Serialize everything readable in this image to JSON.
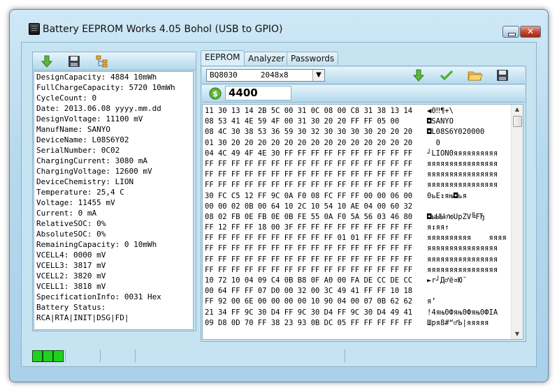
{
  "window": {
    "title": "Battery EEPROM Works  4.05 Bohol (USB to GPIO)",
    "close_label": "✕"
  },
  "left_toolbar": {
    "icons": [
      "read-arrow-icon",
      "save-icon",
      "tree-icon"
    ]
  },
  "info_lines": [
    "DesignCapacity: 4884 10mWh",
    "FullChargeCapacity: 5720 10mWh",
    "CycleCount: 0",
    "Date: 2013.06.08 yyyy.mm.dd",
    "DesignVoltage: 11100 mV",
    "ManufName: SANYO",
    "DeviceName: L08S6Y02",
    "SerialNumber: 0C02",
    "ChargingCurrent: 3080 mA",
    "ChargingVoltage: 12600 mV",
    "DeviceChemistry: LION",
    "Temperature: 25,4 C",
    "Voltage: 11455 mV",
    "Current: 0 mA",
    "RelativeSOC: 0%",
    "AbsoluteSOC: 0%",
    "RemainingCapacity: 0 10mWh",
    "VCELL4: 0000 mV",
    "VCELL3: 3817 mV",
    "VCELL2: 3820 mV",
    "VCELL1: 3818 mV",
    "SpecificationInfo: 0031 Hex",
    "Battery Status:",
    "RCA|RTA|INIT|DSG|FD|"
  ],
  "tabs": [
    "EEPROM",
    "Analyzer",
    "Passwords"
  ],
  "device_select": {
    "value": "BQ8030     2048x8",
    "arrow": "▼"
  },
  "size_field": "4400",
  "hex_rows": [
    {
      "bytes": "11 30 13 14 2B 5C 00 31 0C 08 00 C8 31 38 13 14",
      "ascii": "◀0‼¶+\\"
    },
    {
      "bytes": "08 53 41 4E 59 4F 00 31 30 20 20 FF FF 05 00",
      "ascii": "◘SANYO"
    },
    {
      "bytes": "08 4C 30 38 53 36 59 30 32 30 30 30 30 20 20 20",
      "ascii": "◘L08S6Y020000"
    },
    {
      "bytes": "01 30 20 20 20 20 20 20 20 20 20 20 20 20 20 20",
      "ascii": "  0"
    },
    {
      "bytes": "04 4C 49 4F 4E 30 FF FF FF FF FF FF FF FF FF FF",
      "ascii": "┘LION0яяяяяяяяяя"
    },
    {
      "bytes": "FF FF FF FF FF FF FF FF FF FF FF FF FF FF FF FF",
      "ascii": "яяяяяяяяяяяяяяяя"
    },
    {
      "bytes": "FF FF FF FF FF FF FF FF FF FF FF FF FF FF FF FF",
      "ascii": "яяяяяяяяяяяяяяяя"
    },
    {
      "bytes": "FF FF FF FF FF FF FF FF FF FF FF FF FF FF FF FF",
      "ascii": "яяяяяяяяяяяяяяяя"
    },
    {
      "bytes": "30 FC C5 12 FF 9C 0A F0 08 FC FF FF 00 00 06 00",
      "ascii": "0ьЕ↕яњ◘ья"
    },
    {
      "bytes": "00 00 02 0B 00 64 10 2C 10 54 10 AE 04 00 60 32",
      "ascii": ""
    },
    {
      "bytes": "08 02 FB 0E FB 0E 0B FE 55 0A F0 5A 56 03 46 80",
      "ascii": "◘ыЫЫ♂юUpZV╚FЂ"
    },
    {
      "bytes": "FF 12 FF FF 18 00 3F FF FF FF FF FF FF FF FF FF",
      "ascii": "я↕яя↑"
    },
    {
      "bytes": "FF FF FF FF FF FF FF FF FF FF 01 01 FF FF FF FF",
      "ascii": "яяяяяяяяяя    яяяя"
    },
    {
      "bytes": "FF FF FF FF FF FF FF FF FF FF FF FF FF FF FF FF",
      "ascii": "яяяяяяяяяяяяяяяя"
    },
    {
      "bytes": "FF FF FF FF FF FF FF FF FF FF FF FF FF FF FF FF",
      "ascii": "яяяяяяяяяяяяяяяя"
    },
    {
      "bytes": "FF FF FF FF FF FF FF FF FF FF FF FF FF FF FF FF",
      "ascii": "яяяяяяяяяяяяяяяя"
    },
    {
      "bytes": "10 72 10 04 09 C4 0B B8 0F A0 00 FA DE CC DE CC",
      "ascii": "►r┘Д♂ё¤Ю̆"
    },
    {
      "bytes": "00 64 FF FF 07 D0 00 32 00 3C 49 41 FF FF 10 18",
      "ascii": ""
    },
    {
      "bytes": "FF 92 00 6E 00 00 00 00 10 90 04 00 07 0B 62 62",
      "ascii": "я’"
    },
    {
      "bytes": "21 34 FF 9C 30 D4 FF 9C 30 D4 FF 9C 30 D4 49 41",
      "ascii": "!4яњ0Фяњ0Фяњ0ФIA"
    },
    {
      "bytes": "09 D8 0D 70 FF 38 23 93 0B DC 05 FF FF FF FF FF",
      "ascii": "Шpя8#“♂Ь|яяяяя"
    }
  ]
}
